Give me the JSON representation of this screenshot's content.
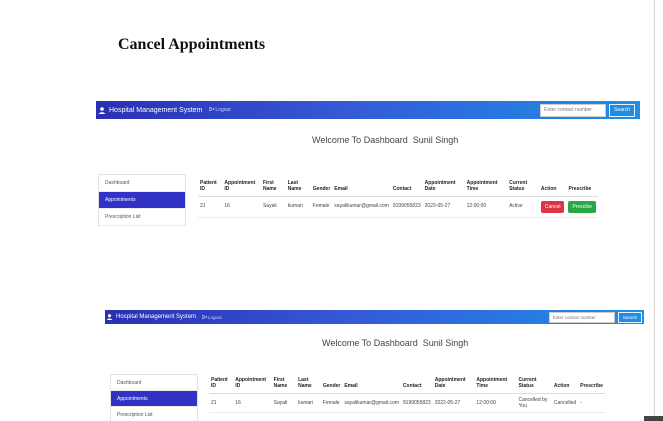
{
  "page_heading": "Cancel Appointments",
  "icons": {
    "brand": "user-doctor-icon",
    "logout": "sign-out-icon"
  },
  "colors": {
    "nav_start": "#2a2fb3",
    "nav_end": "#1f8fe6",
    "sidebar_active": "#2f32c4",
    "cancel": "#dc3545",
    "prescribe": "#28a745"
  },
  "screens": [
    {
      "brand": "Hospital Management System",
      "logout": "Logout",
      "search_placeholder": "Enter contact number",
      "search_button": "Search",
      "welcome": "Welcome To Dashboard  Sunil Singh",
      "sidebar": [
        "Dashboard",
        "Appointments",
        "Prescription List"
      ],
      "active_sidebar": 1,
      "headers": [
        "Patient ID",
        "Appointment ID",
        "First Name",
        "Last Name",
        "Gender",
        "Email",
        "Contact",
        "Appointment Date",
        "Appointment Time",
        "Current Status",
        "Action",
        "Prescribe"
      ],
      "row": {
        "patient_id": "21",
        "appointment_id": "16",
        "first_name": "Sayali",
        "last_name": "kumari",
        "gender": "Female",
        "email": "sayalikumar@gmail.com",
        "contact": "9199055823",
        "date": "2022-05-27",
        "time": "12:00:00",
        "status": "Active",
        "action": "Cancel",
        "prescribe": "Prescibe"
      }
    },
    {
      "brand": "Hospital Management System",
      "logout": "Logout",
      "search_placeholder": "Enter contact number",
      "search_button": "Search",
      "welcome": "Welcome To Dashboard  Sunil Singh",
      "sidebar": [
        "Dashboard",
        "Appointments",
        "Prescription List"
      ],
      "active_sidebar": 1,
      "headers": [
        "Patient ID",
        "Appointment ID",
        "First Name",
        "Last Name",
        "Gender",
        "Email",
        "Contact",
        "Appointment Date",
        "Appointment Time",
        "Current Status",
        "Action",
        "Prescribe"
      ],
      "row": {
        "patient_id": "21",
        "appointment_id": "16",
        "first_name": "Sayali",
        "last_name": "kumari",
        "gender": "Female",
        "email": "sayalikumar@gmail.com",
        "contact": "9199055823",
        "date": "2022-05-27",
        "time": "12:00:00",
        "status": "Cancelled by You",
        "action": "Cancelled",
        "prescribe": "-"
      }
    }
  ]
}
